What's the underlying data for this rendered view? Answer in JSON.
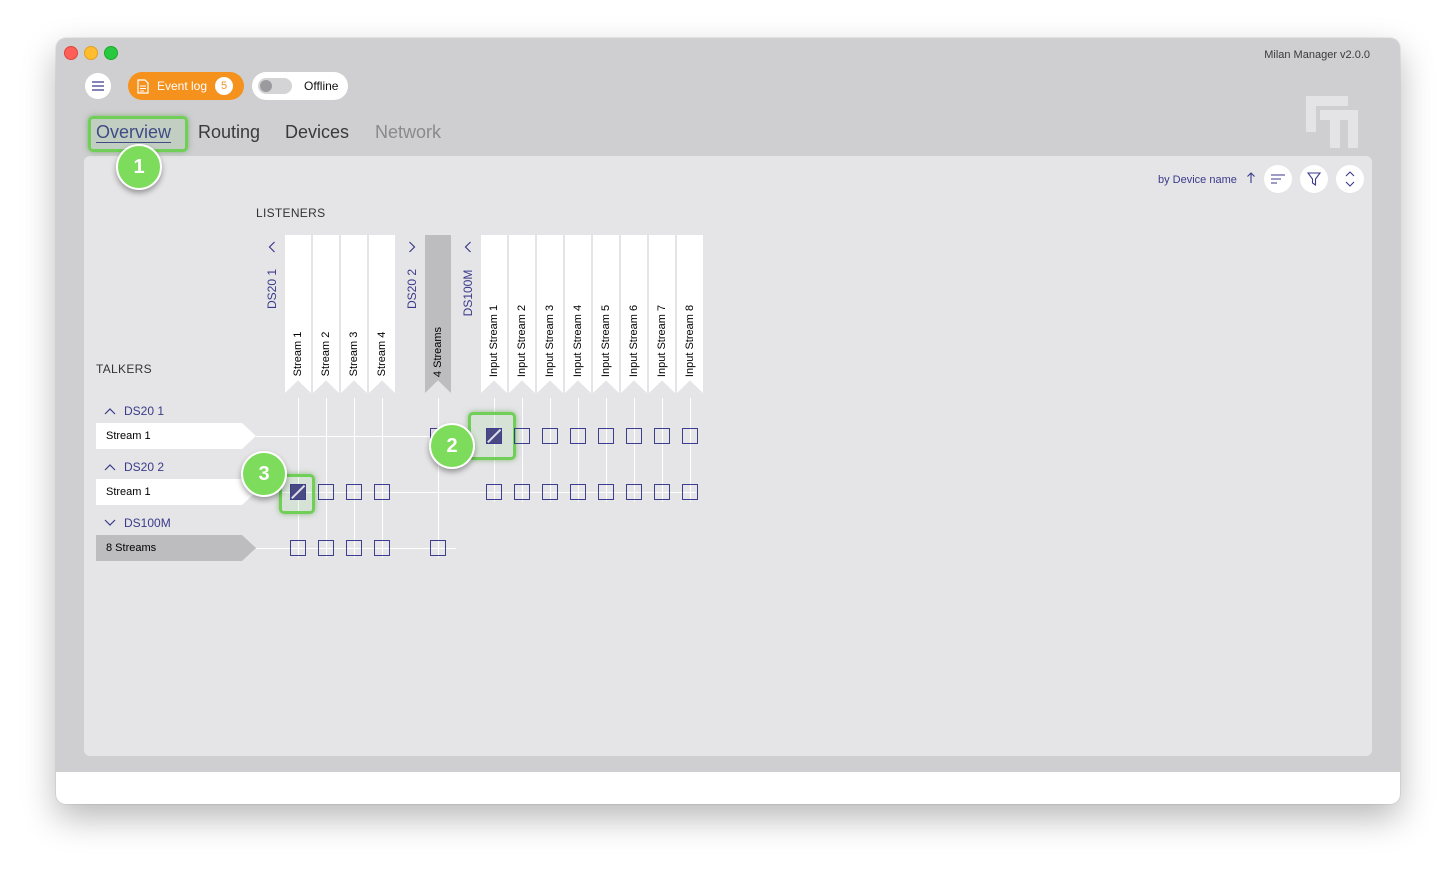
{
  "window": {
    "title": "Milan Manager v2.0.0"
  },
  "toolbar": {
    "event_log_label": "Event log",
    "event_log_count": "5",
    "status_label": "Offline"
  },
  "tabs": [
    {
      "label": "Overview",
      "active": true
    },
    {
      "label": "Routing",
      "active": false
    },
    {
      "label": "Devices",
      "active": false
    },
    {
      "label": "Network",
      "active": false,
      "disabled": true
    }
  ],
  "sort": {
    "label": "by Device name",
    "direction": "up"
  },
  "listeners": {
    "title": "LISTENERS",
    "devices": [
      {
        "name": "DS20 1",
        "expanded": true,
        "streams": [
          "Stream 1",
          "Stream 2",
          "Stream 3",
          "Stream 4"
        ]
      },
      {
        "name": "DS20 2",
        "expanded": false,
        "collapsed_label": "4 Streams"
      },
      {
        "name": "DS100M",
        "expanded": true,
        "streams": [
          "Input Stream 1",
          "Input Stream 2",
          "Input Stream 3",
          "Input Stream 4",
          "Input Stream 5",
          "Input Stream 6",
          "Input Stream 7",
          "Input Stream 8"
        ]
      }
    ]
  },
  "talkers": {
    "title": "TALKERS",
    "devices": [
      {
        "name": "DS20 1",
        "expanded": true,
        "streams": [
          "Stream 1"
        ]
      },
      {
        "name": "DS20 2",
        "expanded": true,
        "streams": [
          "Stream 1"
        ]
      },
      {
        "name": "DS100M",
        "expanded": false,
        "collapsed_label": "8 Streams"
      }
    ]
  },
  "connections": [
    {
      "talker": "DS20 1 / Stream 1",
      "listener": "DS100M / Input Stream 1"
    },
    {
      "talker": "DS20 2 / Stream 1",
      "listener": "DS20 1 / Stream 1"
    }
  ],
  "callouts": [
    "1",
    "2",
    "3"
  ],
  "colors": {
    "accent": "#3a3a8a",
    "event_log": "#f5921e",
    "callout": "#7ddc5c",
    "window_bg": "#cfcfd1",
    "panel_bg": "#e5e5e7"
  }
}
